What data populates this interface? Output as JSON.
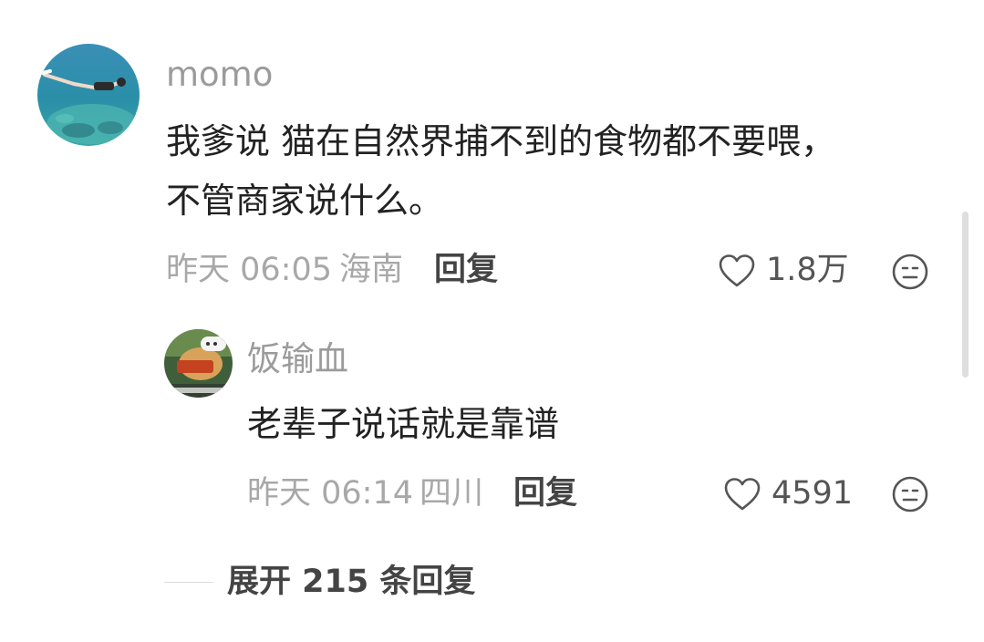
{
  "comments": [
    {
      "username": "momo",
      "text_lines": [
        "我爹说 猫在自然界捕不到的食物都不要喂，",
        "不管商家说什么。"
      ],
      "time": "昨天 06:05",
      "location": "海南",
      "reply_label": "回复",
      "likes": "1.8万",
      "avatar_icon": "swimmer-ocean-photo",
      "like_icon": "heart-outline-icon",
      "dislike_icon": "neutral-face-icon"
    },
    {
      "username": "饭输血",
      "text_lines": [
        "老辈子说话就是靠谱"
      ],
      "time": "昨天 06:14",
      "location": "四川",
      "reply_label": "回复",
      "likes": "4591",
      "avatar_icon": "meme-sticker-photo",
      "like_icon": "heart-outline-icon",
      "dislike_icon": "neutral-face-icon"
    }
  ],
  "expand_replies": {
    "label": "展开 215 条回复"
  },
  "colors": {
    "background": "#ffffff",
    "username": "#9b9b9b",
    "text": "#222222",
    "meta": "#a8a8a8",
    "reply": "#444444"
  }
}
